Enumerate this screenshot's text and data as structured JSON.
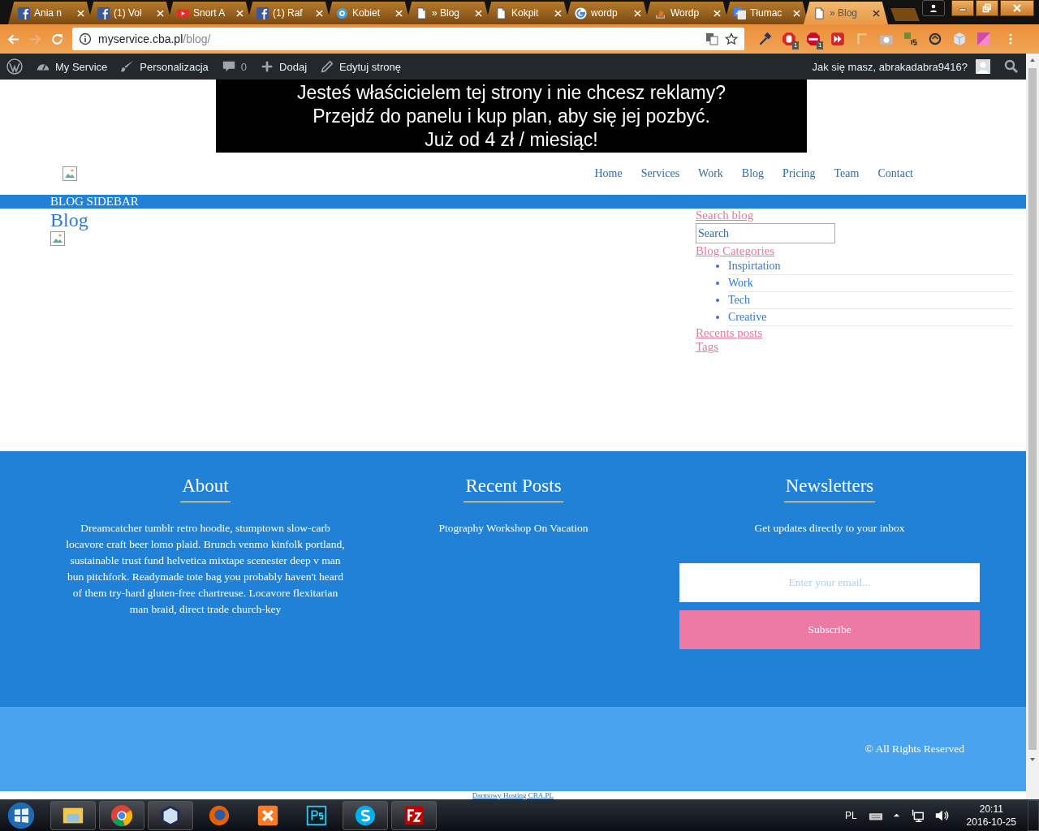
{
  "browser": {
    "tabs": [
      {
        "title": "Ania n",
        "kind": "facebook",
        "selected": false
      },
      {
        "title": "(1) Vol",
        "kind": "facebook",
        "selected": false
      },
      {
        "title": "Snort A",
        "kind": "youtube",
        "selected": false
      },
      {
        "title": "(1) Raf",
        "kind": "facebook",
        "selected": false
      },
      {
        "title": "Kobiet",
        "kind": "eye",
        "selected": false
      },
      {
        "title": "» Blog",
        "kind": "page",
        "selected": false
      },
      {
        "title": "Kokpit",
        "kind": "page",
        "selected": false
      },
      {
        "title": "wordp",
        "kind": "google",
        "selected": false
      },
      {
        "title": "Wordp",
        "kind": "stack",
        "selected": false
      },
      {
        "title": "Tłumac",
        "kind": "translate",
        "selected": false
      },
      {
        "title": "» Blog",
        "kind": "page",
        "selected": true
      }
    ],
    "address": {
      "host": "myservice.cba.pl",
      "path": "/blog/"
    },
    "extensions": [
      {
        "kind": "dropper"
      },
      {
        "kind": "hand",
        "badge": "1"
      },
      {
        "kind": "stop",
        "badge": "1"
      },
      {
        "kind": "forward"
      },
      {
        "kind": "ruler"
      },
      {
        "kind": "camera"
      },
      {
        "kind": "js"
      },
      {
        "kind": "sync"
      },
      {
        "kind": "cube"
      },
      {
        "kind": "gradient"
      }
    ]
  },
  "admin_bar": {
    "site": "My Service",
    "customize": "Personalizacja",
    "comments": "0",
    "new": "Dodaj",
    "edit": "Edytuj stronę",
    "greeting": "Jak się masz, abrakadabra9416?"
  },
  "ad_banner": {
    "lines": [
      "Jesteś właścicielem tej strony i nie chcesz reklamy?",
      "Przejdź do panelu i kup plan, aby się jej pozbyć.",
      "Już od 4 zł / miesiąc!"
    ]
  },
  "nav": [
    {
      "label": "Home"
    },
    {
      "label": "Services"
    },
    {
      "label": "Work"
    },
    {
      "label": "Blog"
    },
    {
      "label": "Pricing"
    },
    {
      "label": "Team"
    },
    {
      "label": "Contact"
    }
  ],
  "sidebar_bar": "BLOG SIDEBAR",
  "page_title": "Blog",
  "sidebar": {
    "search_heading": "Search blog",
    "search_value": "Search",
    "categories_heading": "Blog Categories",
    "categories": [
      "Inspirtation",
      "Work",
      "Tech",
      "Creative"
    ],
    "recent_heading": "Recents posts",
    "tags_heading": "Tags"
  },
  "footer": {
    "about": {
      "title": "About",
      "text": "Dreamcatcher tumblr retro hoodie, stumptown slow-carb locavore craft beer lomo plaid. Brunch venmo kinfolk portland, sustainable trust fund helvetica mixtape scenester deep v man bun pitchfork. Readymade tote bag you probably haven't heard of them try-hard gluten-free chartreuse. Locavore flexitarian man braid, direct trade church-key"
    },
    "recent": {
      "title": "Recent Posts",
      "posts": [
        "Ptography Workshop On Vacation"
      ]
    },
    "newsletter": {
      "title": "Newsletters",
      "text": "Get updates directly to your inbox",
      "placeholder": "Enter your email...",
      "button": "Subscribe"
    },
    "copyright": "© All Rights Reserved",
    "hosting": "Darmowy Hosting CBA.PL"
  },
  "taskbar": {
    "apps": [
      {
        "kind": "explorer",
        "pinned_open": true
      },
      {
        "kind": "chrome",
        "pinned_open": true
      },
      {
        "kind": "cube",
        "pinned_open": true
      },
      {
        "kind": "firefox",
        "pinned_open": false
      },
      {
        "kind": "xampp",
        "pinned_open": false
      },
      {
        "kind": "photoshop",
        "pinned_open": false
      },
      {
        "kind": "skype",
        "pinned_open": true
      },
      {
        "kind": "filezilla",
        "pinned_open": true
      }
    ],
    "language": "PL",
    "time": "20:11",
    "date": "2016-10-25"
  }
}
